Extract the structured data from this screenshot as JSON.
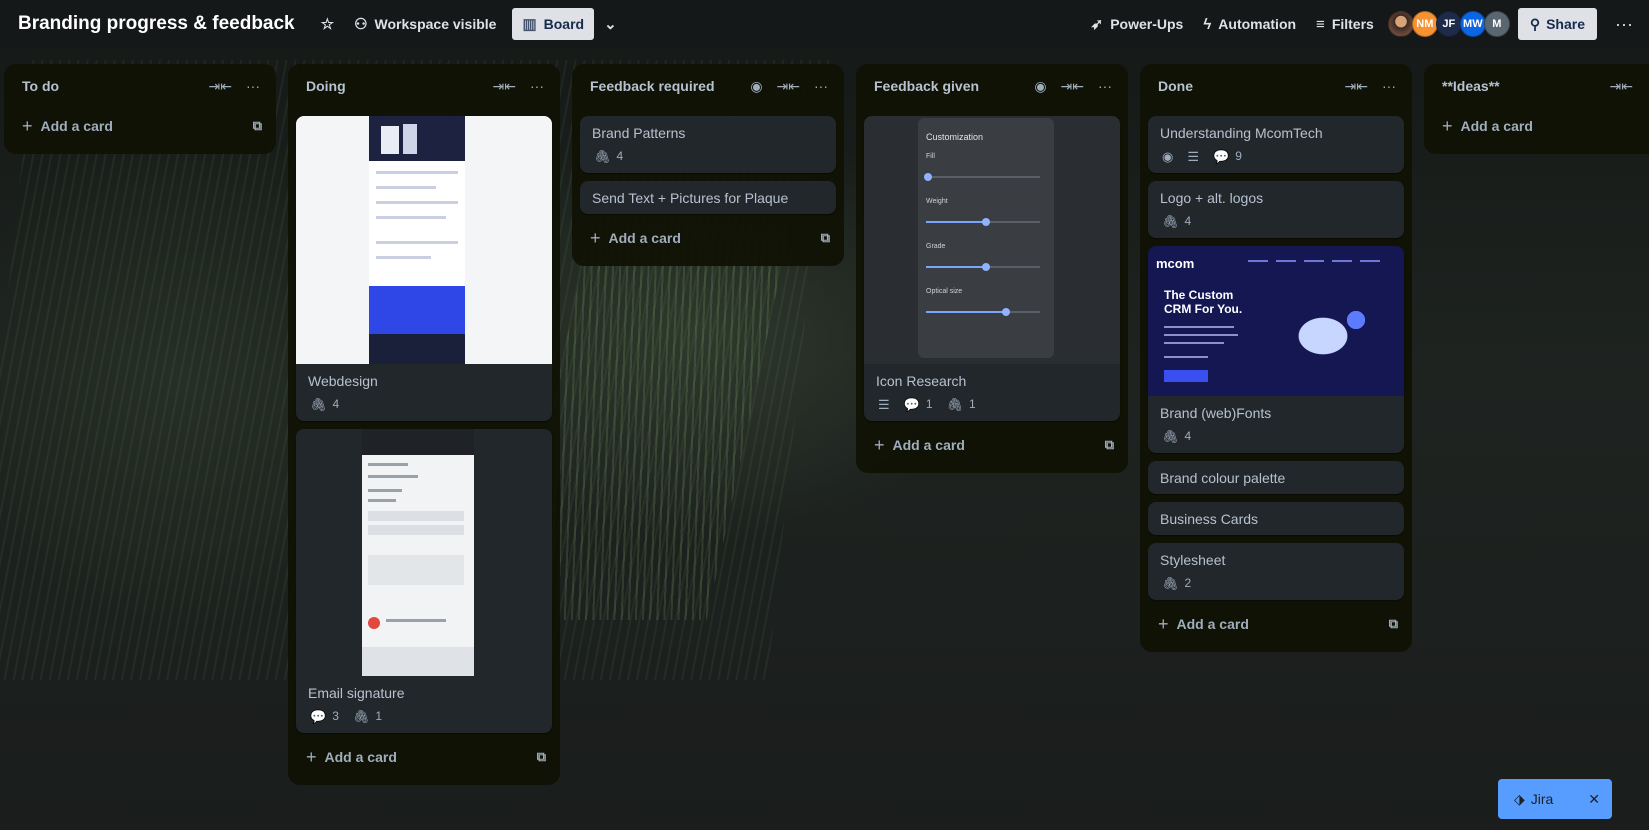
{
  "header": {
    "board_title": "Branding progress & feedback",
    "visibility_label": "Workspace visible",
    "view_label": "Board",
    "powerups_label": "Power-Ups",
    "automation_label": "Automation",
    "filters_label": "Filters",
    "share_label": "Share",
    "members": [
      {
        "initials": "",
        "color": "#6b4a3a"
      },
      {
        "initials": "NM",
        "color": "#f79233"
      },
      {
        "initials": "JF",
        "color": "#1d2a4a"
      },
      {
        "initials": "MW",
        "color": "#0c66e4"
      },
      {
        "initials": "M",
        "color": "#5a6670"
      }
    ]
  },
  "lists": [
    {
      "title": "To do",
      "add_label": "Add a card"
    },
    {
      "title": "Doing",
      "add_label": "Add a card",
      "cards": [
        {
          "title": "Webdesign",
          "attachments": "4"
        },
        {
          "title": "Email signature",
          "comments": "3",
          "attachments": "1"
        }
      ]
    },
    {
      "title": "Feedback required",
      "add_label": "Add a card",
      "cards": [
        {
          "title": "Brand Patterns",
          "attachments": "4"
        },
        {
          "title": "Send Text + Pictures for Plaque"
        }
      ]
    },
    {
      "title": "Feedback given",
      "add_label": "Add a card",
      "cards": [
        {
          "title": "Icon Research",
          "comments": "1",
          "attachments": "1",
          "cover_text": {
            "panel_title": "Customization",
            "fill": "Fill",
            "weight": "Weight",
            "grade": "Grade",
            "optical": "Optical size"
          }
        }
      ]
    },
    {
      "title": "Done",
      "add_label": "Add a card",
      "cards": [
        {
          "title": "Understanding McomTech",
          "comments": "9"
        },
        {
          "title": "Logo + alt. logos",
          "attachments": "4"
        },
        {
          "title": "Brand (web)Fonts",
          "attachments": "4",
          "cover_text": {
            "logo": "mcom",
            "headline_1": "The Custom",
            "headline_2": "CRM For You."
          }
        },
        {
          "title": "Brand colour palette"
        },
        {
          "title": "Business Cards"
        },
        {
          "title": "Stylesheet",
          "attachments": "2"
        }
      ]
    },
    {
      "title": "**Ideas**",
      "add_label": "Add a card"
    }
  ],
  "jira": {
    "label": "Jira"
  },
  "icons": {
    "star": "star-icon",
    "visibility": "people-icon",
    "board": "board-icon",
    "chevron": "chevron-down-icon",
    "powerups": "rocket-icon",
    "automation": "lightning-icon",
    "filters": "filter-icon",
    "share": "person-add-icon",
    "more": "more-icon",
    "collapse": "collapse-icon",
    "watch": "eye-icon",
    "description": "description-icon",
    "comment": "comment-icon",
    "attachment": "paperclip-icon",
    "template": "template-icon",
    "close": "close-icon"
  }
}
